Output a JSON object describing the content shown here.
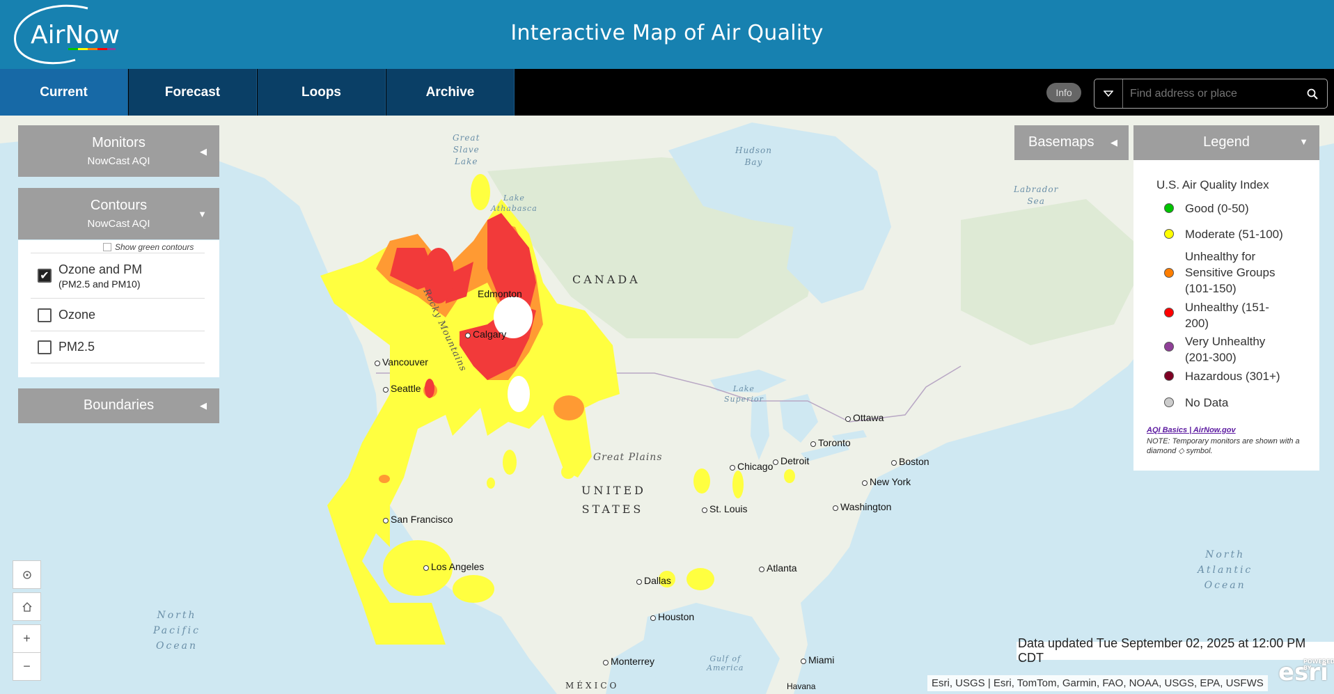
{
  "header": {
    "logo_text": "AirNow",
    "title": "Interactive Map of Air Quality"
  },
  "nav": {
    "tabs": [
      {
        "label": "Current",
        "active": true
      },
      {
        "label": "Forecast"
      },
      {
        "label": "Loops"
      },
      {
        "label": "Archive"
      }
    ]
  },
  "toolbar": {
    "info_label": "Info",
    "search_placeholder": "Find address or place"
  },
  "panels": {
    "monitors": {
      "title": "Monitors",
      "subtitle": "NowCast AQI"
    },
    "contours": {
      "title": "Contours",
      "subtitle": "NowCast AQI",
      "show_green_label": "Show green contours",
      "show_green_checked": false,
      "options": [
        {
          "label": "Ozone and PM",
          "sublabel": "(PM2.5 and PM10)",
          "checked": true
        },
        {
          "label": "Ozone",
          "checked": false
        },
        {
          "label": "PM2.5",
          "checked": false
        }
      ]
    },
    "boundaries": {
      "title": "Boundaries"
    },
    "basemaps": {
      "title": "Basemaps"
    }
  },
  "legend": {
    "title": "Legend",
    "heading": "U.S. Air Quality Index",
    "items": [
      {
        "label": "Good (0-50)",
        "color": "#00c400"
      },
      {
        "label": "Moderate (51-100)",
        "color": "#ffff00"
      },
      {
        "label": "Unhealthy for Sensitive Groups (101-150)",
        "color": "#ff7e00"
      },
      {
        "label": "Unhealthy (151-200)",
        "color": "#ff0000"
      },
      {
        "label": "Very Unhealthy (201-300)",
        "color": "#8f3f97"
      },
      {
        "label": "Hazardous (301+)",
        "color": "#7e0023"
      },
      {
        "label": "No Data",
        "color": "#cccccc"
      }
    ],
    "link": "AQI Basics | AirNow.gov",
    "note": "NOTE: Temporary monitors are shown with a diamond ◇ symbol."
  },
  "map": {
    "countries": [
      "CANADA",
      "UNITED STATES",
      "MÉXICO"
    ],
    "water": [
      {
        "name": "Great Slave Lake",
        "lines": [
          "Great",
          "Slave",
          "Lake"
        ]
      },
      {
        "name": "Hudson Bay",
        "lines": [
          "Hudson",
          "Bay"
        ]
      },
      {
        "name": "Labrador Sea",
        "lines": [
          "Labrador",
          "Sea"
        ]
      },
      {
        "name": "Lake Athabasca",
        "lines": [
          "Lake",
          "Athabasca"
        ]
      },
      {
        "name": "Lake Superior",
        "lines": [
          "Lake",
          "Superior"
        ]
      },
      {
        "name": "North Pacific Ocean",
        "lines": [
          "North",
          "Pacific",
          "Ocean"
        ]
      },
      {
        "name": "North Atlantic Ocean",
        "lines": [
          "North",
          "Atlantic",
          "Ocean"
        ]
      },
      {
        "name": "Gulf of America",
        "lines": [
          "Gulf of",
          "America"
        ]
      }
    ],
    "regions": [
      "Rocky Mountains",
      "Great Plains"
    ],
    "cities": [
      "Edmonton",
      "Calgary",
      "Vancouver",
      "Seattle",
      "San Francisco",
      "Los Angeles",
      "Dallas",
      "Houston",
      "Monterrey",
      "Chicago",
      "Detroit",
      "Toronto",
      "Ottawa",
      "Boston",
      "New York",
      "Washington",
      "St. Louis",
      "Atlanta",
      "Miami",
      "Havana"
    ]
  },
  "footer": {
    "updated": "Data updated Tue September 02, 2025 at 12:00 PM CDT",
    "attribution": "Esri, USGS | Esri, TomTom, Garmin, FAO, NOAA, USGS, EPA, USFWS",
    "esri_logo": "esri",
    "esri_powered": "POWERED BY"
  },
  "colors": {
    "header": "#1781b0",
    "nav_tab": "#0a3f66",
    "nav_active": "#1769a6",
    "panel": "#9e9e9e"
  }
}
